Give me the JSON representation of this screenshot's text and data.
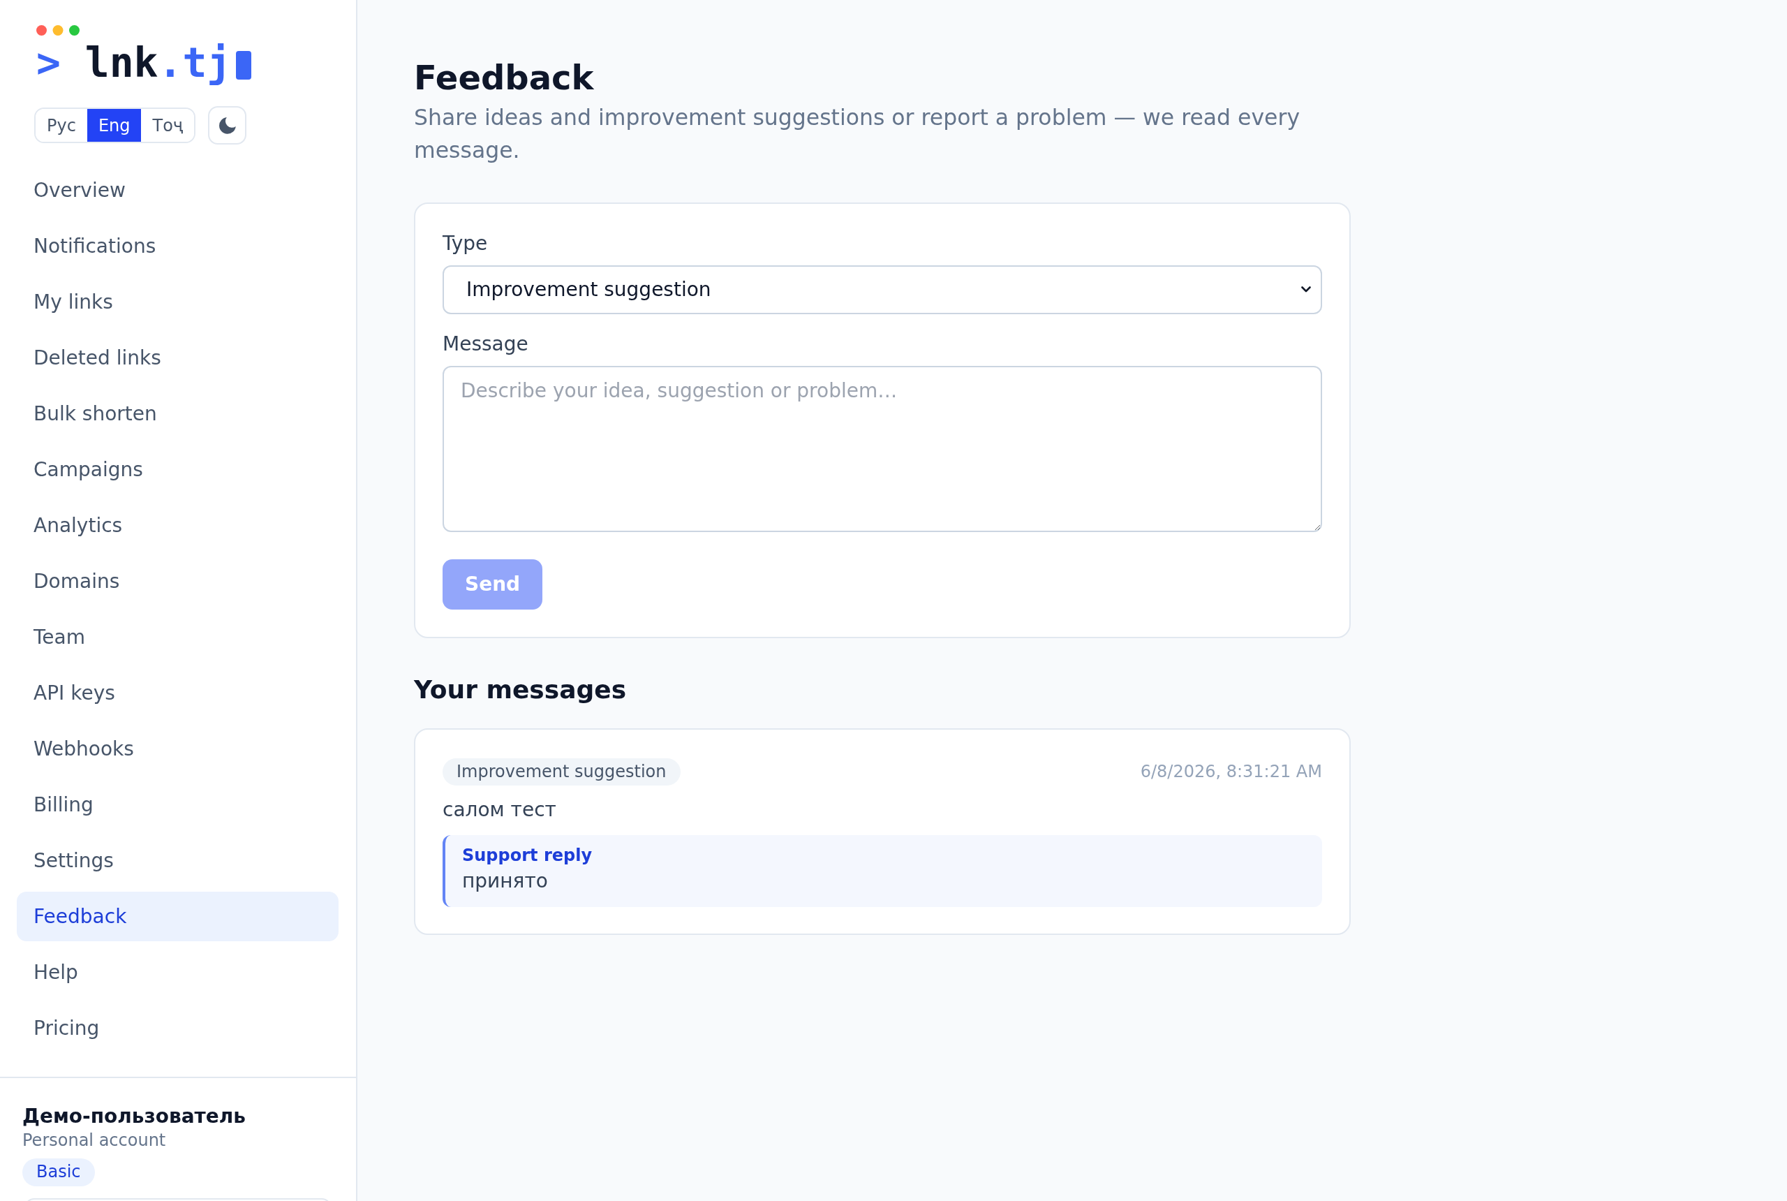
{
  "sidebar": {
    "logo": {
      "prompt": ">",
      "name": "lnk",
      "domain": ".tj"
    },
    "languages": [
      {
        "label": "Рус",
        "selected": false
      },
      {
        "label": "Eng",
        "selected": true
      },
      {
        "label": "Тоҷ",
        "selected": false
      }
    ],
    "nav": [
      {
        "label": "Overview",
        "selected": false
      },
      {
        "label": "Notifications",
        "selected": false
      },
      {
        "label": "My links",
        "selected": false
      },
      {
        "label": "Deleted links",
        "selected": false
      },
      {
        "label": "Bulk shorten",
        "selected": false
      },
      {
        "label": "Campaigns",
        "selected": false
      },
      {
        "label": "Analytics",
        "selected": false
      },
      {
        "label": "Domains",
        "selected": false
      },
      {
        "label": "Team",
        "selected": false
      },
      {
        "label": "API keys",
        "selected": false
      },
      {
        "label": "Webhooks",
        "selected": false
      },
      {
        "label": "Billing",
        "selected": false
      },
      {
        "label": "Settings",
        "selected": false
      },
      {
        "label": "Feedback",
        "selected": true
      },
      {
        "label": "Help",
        "selected": false
      },
      {
        "label": "Pricing",
        "selected": false
      }
    ],
    "account": {
      "name": "Демо-пользователь",
      "type": "Personal account",
      "plan": "Basic"
    }
  },
  "page": {
    "title": "Feedback",
    "subtitle": "Share ideas and improvement suggestions or report a problem — we read every message."
  },
  "form": {
    "type_label": "Type",
    "type_value": "Improvement suggestion",
    "message_label": "Message",
    "message_placeholder": "Describe your idea, suggestion or problem…",
    "send": {
      "label": "Send",
      "disabled": true
    }
  },
  "messages": {
    "title": "Your messages",
    "items": [
      {
        "tag": "Improvement suggestion",
        "time": "6/8/2026, 8:31:21 AM",
        "text": "салом тест",
        "reply": {
          "label": "Support reply",
          "text": "принято"
        }
      }
    ]
  }
}
